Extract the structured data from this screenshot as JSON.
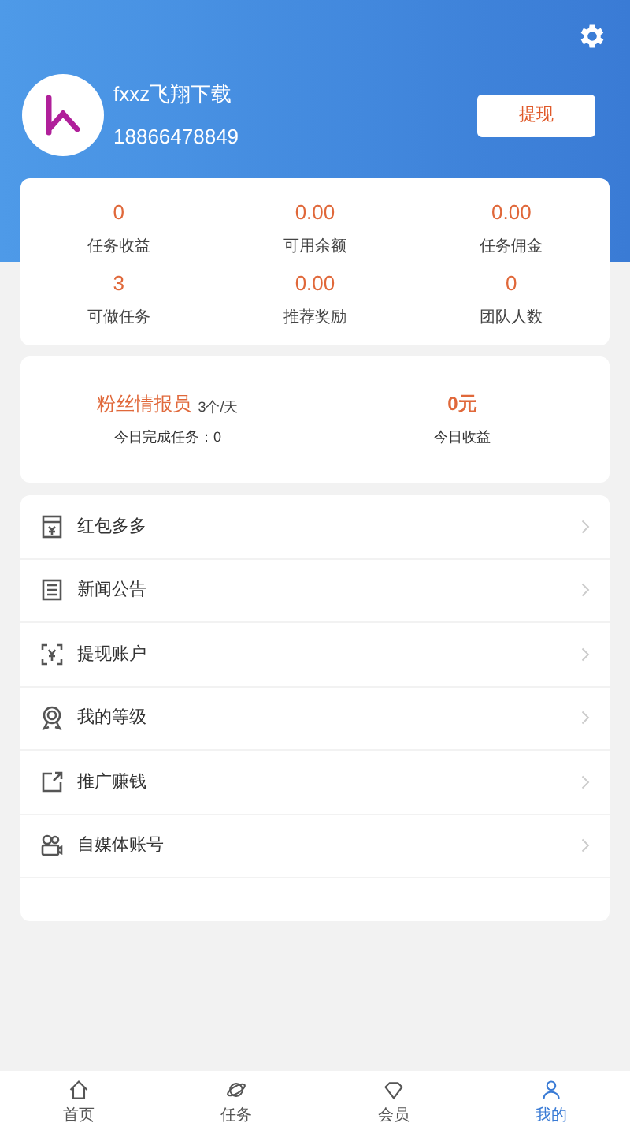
{
  "user": {
    "name": "fxxz飞翔下载",
    "phone": "18866478849"
  },
  "withdraw_button": "提现",
  "stats": [
    {
      "value": "0",
      "label": "任务收益"
    },
    {
      "value": "0.00",
      "label": "可用余额"
    },
    {
      "value": "0.00",
      "label": "任务佣金"
    },
    {
      "value": "3",
      "label": "可做任务"
    },
    {
      "value": "0.00",
      "label": "推荐奖励"
    },
    {
      "value": "0",
      "label": "团队人数"
    }
  ],
  "level_card": {
    "title": "粉丝情报员",
    "quota": "3个/天",
    "done": "今日完成任务：0",
    "income_value": "0元",
    "income_label": "今日收益"
  },
  "menu": [
    {
      "kind": "redpacket",
      "label": "红包多多"
    },
    {
      "kind": "news",
      "label": "新闻公告"
    },
    {
      "kind": "account",
      "label": "提现账户"
    },
    {
      "kind": "level",
      "label": "我的等级"
    },
    {
      "kind": "share",
      "label": "推广赚钱"
    },
    {
      "kind": "media",
      "label": "自媒体账号"
    }
  ],
  "tabs": [
    {
      "kind": "home",
      "label": "首页",
      "selected": false
    },
    {
      "kind": "task",
      "label": "任务",
      "selected": false
    },
    {
      "kind": "member",
      "label": "会员",
      "selected": false
    },
    {
      "kind": "mine",
      "label": "我的",
      "selected": true
    }
  ]
}
